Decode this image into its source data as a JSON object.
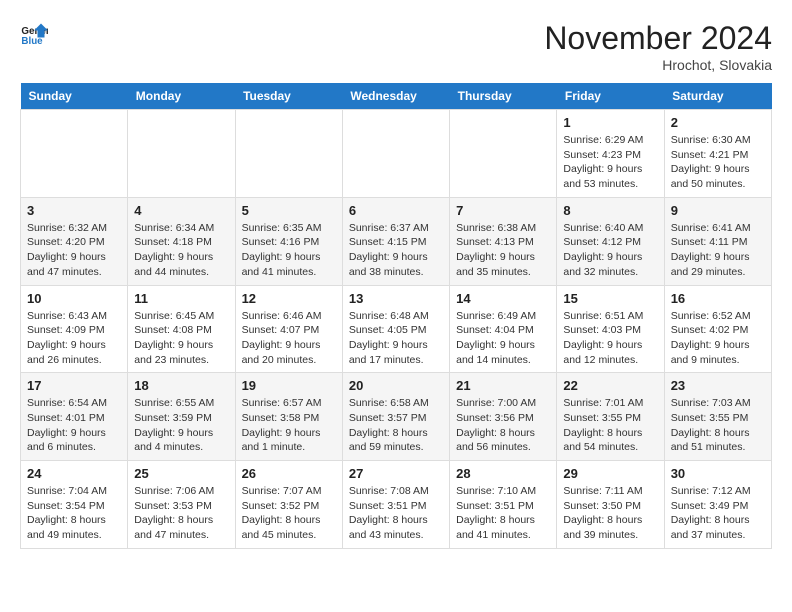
{
  "header": {
    "logo_line1": "General",
    "logo_line2": "Blue",
    "month": "November 2024",
    "location": "Hrochot, Slovakia"
  },
  "days_of_week": [
    "Sunday",
    "Monday",
    "Tuesday",
    "Wednesday",
    "Thursday",
    "Friday",
    "Saturday"
  ],
  "weeks": [
    [
      {
        "day": "",
        "content": ""
      },
      {
        "day": "",
        "content": ""
      },
      {
        "day": "",
        "content": ""
      },
      {
        "day": "",
        "content": ""
      },
      {
        "day": "",
        "content": ""
      },
      {
        "day": "1",
        "content": "Sunrise: 6:29 AM\nSunset: 4:23 PM\nDaylight: 9 hours\nand 53 minutes."
      },
      {
        "day": "2",
        "content": "Sunrise: 6:30 AM\nSunset: 4:21 PM\nDaylight: 9 hours\nand 50 minutes."
      }
    ],
    [
      {
        "day": "3",
        "content": "Sunrise: 6:32 AM\nSunset: 4:20 PM\nDaylight: 9 hours\nand 47 minutes."
      },
      {
        "day": "4",
        "content": "Sunrise: 6:34 AM\nSunset: 4:18 PM\nDaylight: 9 hours\nand 44 minutes."
      },
      {
        "day": "5",
        "content": "Sunrise: 6:35 AM\nSunset: 4:16 PM\nDaylight: 9 hours\nand 41 minutes."
      },
      {
        "day": "6",
        "content": "Sunrise: 6:37 AM\nSunset: 4:15 PM\nDaylight: 9 hours\nand 38 minutes."
      },
      {
        "day": "7",
        "content": "Sunrise: 6:38 AM\nSunset: 4:13 PM\nDaylight: 9 hours\nand 35 minutes."
      },
      {
        "day": "8",
        "content": "Sunrise: 6:40 AM\nSunset: 4:12 PM\nDaylight: 9 hours\nand 32 minutes."
      },
      {
        "day": "9",
        "content": "Sunrise: 6:41 AM\nSunset: 4:11 PM\nDaylight: 9 hours\nand 29 minutes."
      }
    ],
    [
      {
        "day": "10",
        "content": "Sunrise: 6:43 AM\nSunset: 4:09 PM\nDaylight: 9 hours\nand 26 minutes."
      },
      {
        "day": "11",
        "content": "Sunrise: 6:45 AM\nSunset: 4:08 PM\nDaylight: 9 hours\nand 23 minutes."
      },
      {
        "day": "12",
        "content": "Sunrise: 6:46 AM\nSunset: 4:07 PM\nDaylight: 9 hours\nand 20 minutes."
      },
      {
        "day": "13",
        "content": "Sunrise: 6:48 AM\nSunset: 4:05 PM\nDaylight: 9 hours\nand 17 minutes."
      },
      {
        "day": "14",
        "content": "Sunrise: 6:49 AM\nSunset: 4:04 PM\nDaylight: 9 hours\nand 14 minutes."
      },
      {
        "day": "15",
        "content": "Sunrise: 6:51 AM\nSunset: 4:03 PM\nDaylight: 9 hours\nand 12 minutes."
      },
      {
        "day": "16",
        "content": "Sunrise: 6:52 AM\nSunset: 4:02 PM\nDaylight: 9 hours\nand 9 minutes."
      }
    ],
    [
      {
        "day": "17",
        "content": "Sunrise: 6:54 AM\nSunset: 4:01 PM\nDaylight: 9 hours\nand 6 minutes."
      },
      {
        "day": "18",
        "content": "Sunrise: 6:55 AM\nSunset: 3:59 PM\nDaylight: 9 hours\nand 4 minutes."
      },
      {
        "day": "19",
        "content": "Sunrise: 6:57 AM\nSunset: 3:58 PM\nDaylight: 9 hours\nand 1 minute."
      },
      {
        "day": "20",
        "content": "Sunrise: 6:58 AM\nSunset: 3:57 PM\nDaylight: 8 hours\nand 59 minutes."
      },
      {
        "day": "21",
        "content": "Sunrise: 7:00 AM\nSunset: 3:56 PM\nDaylight: 8 hours\nand 56 minutes."
      },
      {
        "day": "22",
        "content": "Sunrise: 7:01 AM\nSunset: 3:55 PM\nDaylight: 8 hours\nand 54 minutes."
      },
      {
        "day": "23",
        "content": "Sunrise: 7:03 AM\nSunset: 3:55 PM\nDaylight: 8 hours\nand 51 minutes."
      }
    ],
    [
      {
        "day": "24",
        "content": "Sunrise: 7:04 AM\nSunset: 3:54 PM\nDaylight: 8 hours\nand 49 minutes."
      },
      {
        "day": "25",
        "content": "Sunrise: 7:06 AM\nSunset: 3:53 PM\nDaylight: 8 hours\nand 47 minutes."
      },
      {
        "day": "26",
        "content": "Sunrise: 7:07 AM\nSunset: 3:52 PM\nDaylight: 8 hours\nand 45 minutes."
      },
      {
        "day": "27",
        "content": "Sunrise: 7:08 AM\nSunset: 3:51 PM\nDaylight: 8 hours\nand 43 minutes."
      },
      {
        "day": "28",
        "content": "Sunrise: 7:10 AM\nSunset: 3:51 PM\nDaylight: 8 hours\nand 41 minutes."
      },
      {
        "day": "29",
        "content": "Sunrise: 7:11 AM\nSunset: 3:50 PM\nDaylight: 8 hours\nand 39 minutes."
      },
      {
        "day": "30",
        "content": "Sunrise: 7:12 AM\nSunset: 3:49 PM\nDaylight: 8 hours\nand 37 minutes."
      }
    ]
  ]
}
